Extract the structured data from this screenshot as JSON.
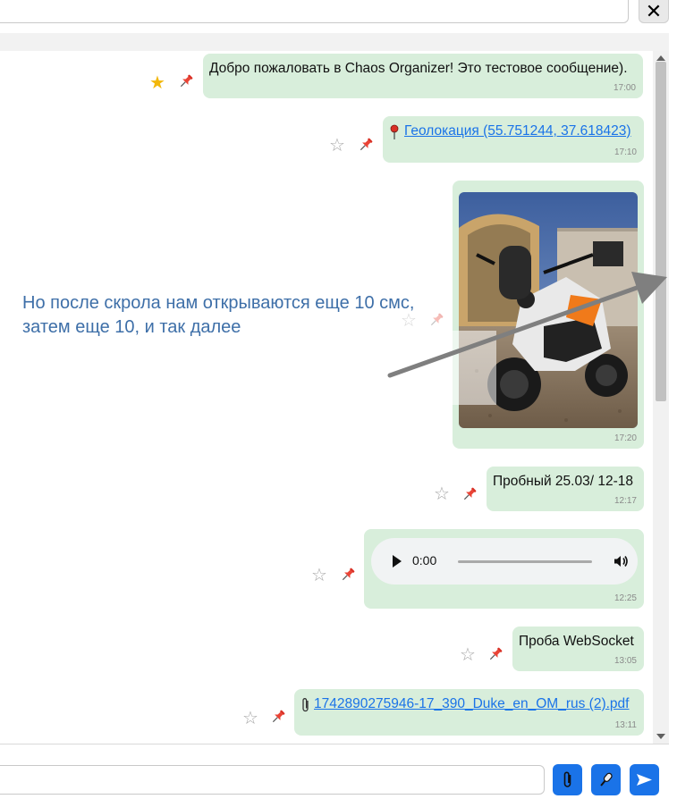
{
  "header": {
    "search_placeholder": "",
    "close_label": "✕"
  },
  "messages": [
    {
      "type": "text",
      "text": "Добро пожаловать в Chaos Organizer! Это тестовое сообщение).",
      "time": "17:00",
      "favorite": true,
      "pinned": true
    },
    {
      "type": "geo",
      "text": "Геолокация (55.751244, 37.618423)",
      "time": "17:10",
      "favorite": false,
      "pinned": true
    },
    {
      "type": "image",
      "alt": "motorcycle photo",
      "time": "17:20",
      "favorite": false,
      "pinned": true
    },
    {
      "type": "text",
      "text": "Пробный 25.03/ 12-18",
      "time": "12:17",
      "favorite": false,
      "pinned": true
    },
    {
      "type": "audio",
      "current_time": "0:00",
      "time": "12:25",
      "favorite": false,
      "pinned": true
    },
    {
      "type": "text",
      "text": "Проба WebSocket",
      "time": "13:05",
      "favorite": false,
      "pinned": true
    },
    {
      "type": "file",
      "text": "1742890275946-17_390_Duke_en_OM_rus (2).pdf",
      "time": "13:11",
      "favorite": false,
      "pinned": true
    }
  ],
  "annotation": {
    "line1": "Но после скрола нам открываются еще 10 смс,",
    "line2": "затем еще 10, и так далее"
  },
  "composer": {
    "placeholder": "",
    "attach_icon": "paperclip-icon",
    "mic_icon": "microphone-icon",
    "send_icon": "send-icon"
  },
  "colors": {
    "bubble": "#d8eedb",
    "accent": "#1a73e8",
    "annotation_text": "#3e6fa8",
    "star_filled": "#f2b70b"
  }
}
